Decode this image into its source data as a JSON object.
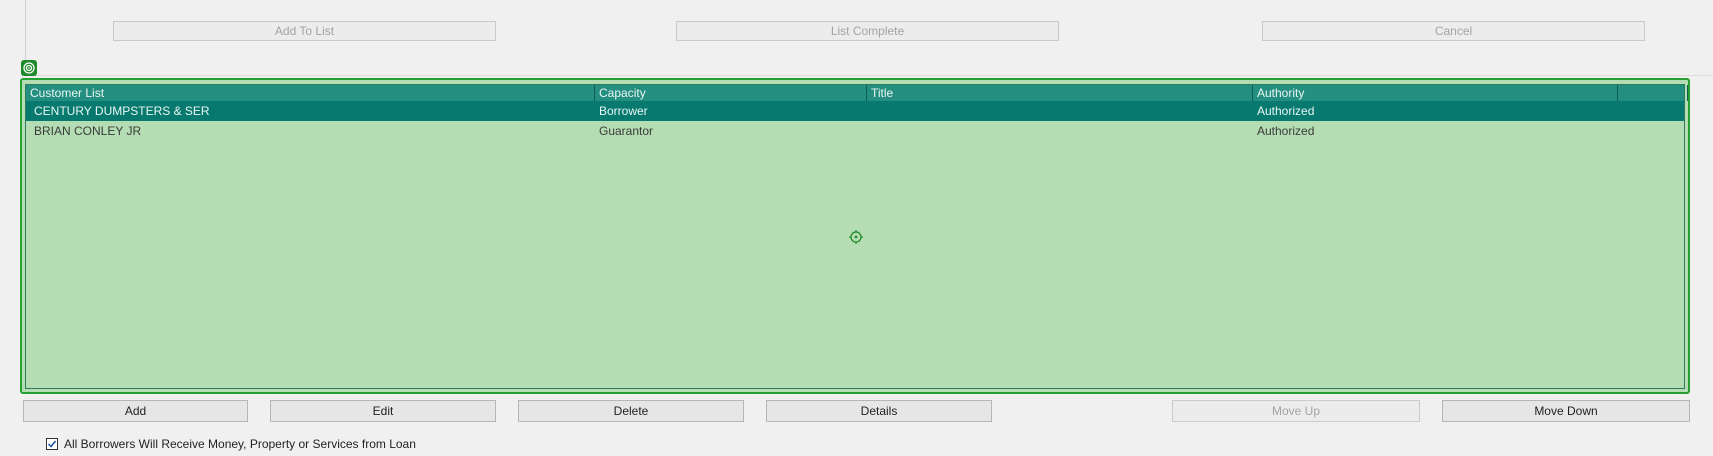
{
  "top_buttons": {
    "add_to_list": "Add To List",
    "list_complete": "List Complete",
    "cancel": "Cancel"
  },
  "grid": {
    "columns": [
      "Customer List",
      "Capacity",
      "Title",
      "Authority",
      ""
    ],
    "rows": [
      {
        "customer": "CENTURY DUMPSTERS & SER",
        "capacity": "Borrower",
        "title": "",
        "authority": "Authorized",
        "selected": true
      },
      {
        "customer": "BRIAN CONLEY  JR",
        "capacity": "Guarantor",
        "title": "",
        "authority": "Authorized",
        "selected": false
      }
    ]
  },
  "bottom_buttons": {
    "add": "Add",
    "edit": "Edit",
    "delete": "Delete",
    "details": "Details",
    "move_up": "Move Up",
    "move_down": "Move Down"
  },
  "checkbox": {
    "label": "All Borrowers Will Receive Money, Property or Services from Loan",
    "checked": true
  },
  "colors": {
    "header": "#248f80",
    "selected_row": "#07796f",
    "grid_bg": "#b4ddb4",
    "frame": "#26a032"
  }
}
